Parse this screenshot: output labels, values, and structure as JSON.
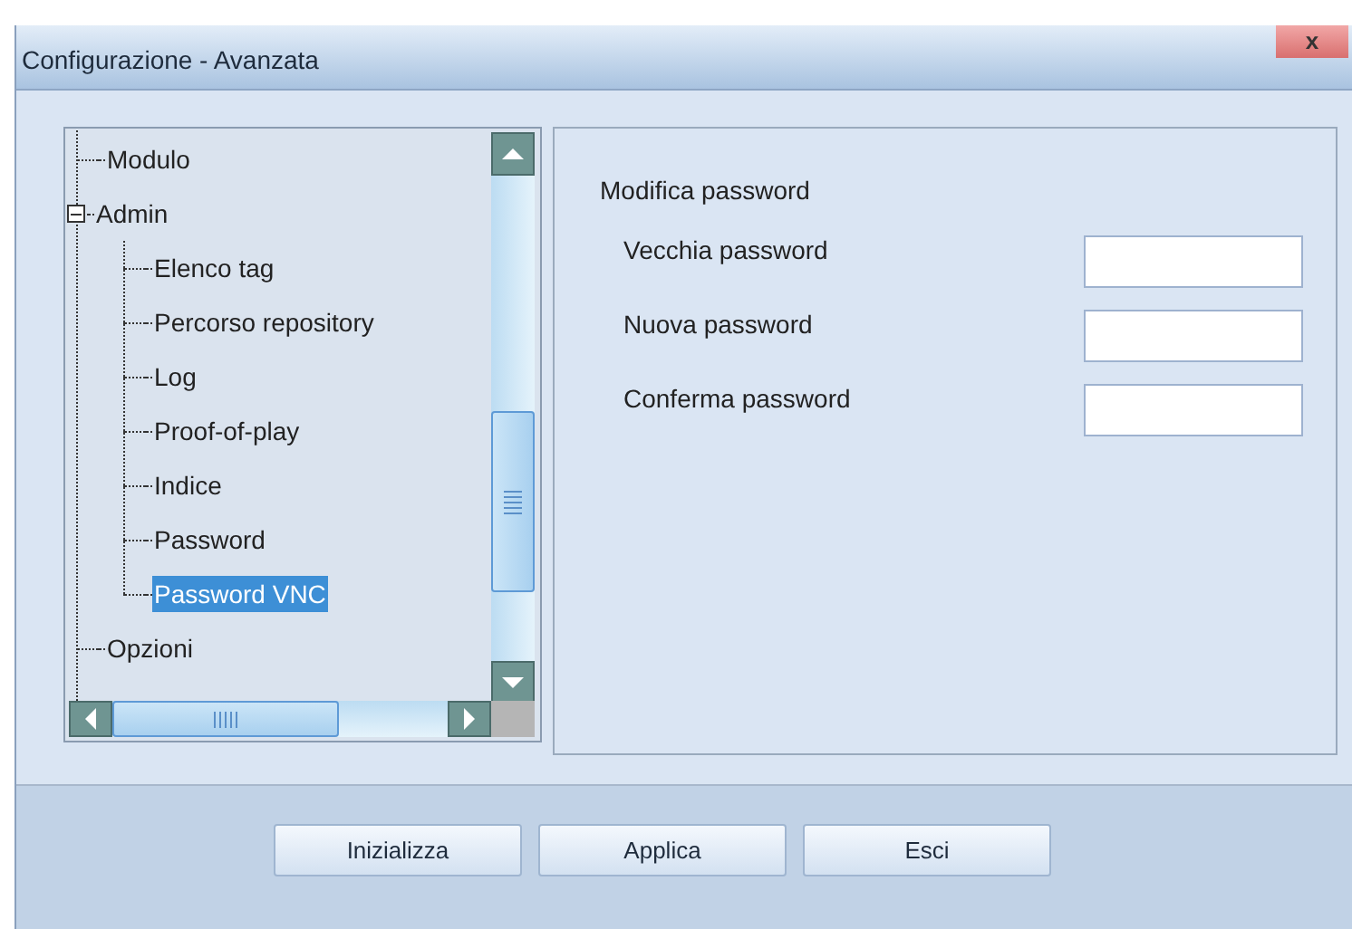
{
  "window": {
    "title": "Configurazione - Avanzata",
    "close_label": "x"
  },
  "tree": {
    "items": [
      {
        "label": "Modulo",
        "selected": false
      },
      {
        "label": "Admin",
        "selected": false,
        "expanded": true,
        "children": [
          {
            "label": "Elenco tag",
            "selected": false
          },
          {
            "label": "Percorso repository",
            "selected": false
          },
          {
            "label": "Log",
            "selected": false
          },
          {
            "label": "Proof-of-play",
            "selected": false
          },
          {
            "label": "Indice",
            "selected": false
          },
          {
            "label": "Password",
            "selected": false
          },
          {
            "label": "Password VNC",
            "selected": true
          }
        ]
      },
      {
        "label": "Opzioni",
        "selected": false
      }
    ]
  },
  "form": {
    "heading": "Modifica password",
    "fields": [
      {
        "label": "Vecchia password"
      },
      {
        "label": "Nuova password"
      },
      {
        "label": "Conferma password"
      }
    ]
  },
  "buttons": [
    "Inizializza",
    "Applica",
    "Esci"
  ]
}
